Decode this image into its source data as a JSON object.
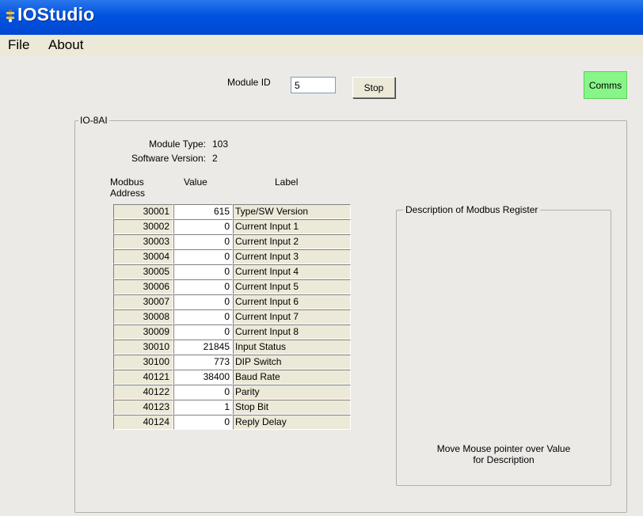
{
  "window": {
    "title": "IOStudio",
    "icon": "app-icon"
  },
  "menu": {
    "items": [
      "File",
      "About"
    ]
  },
  "toolbar": {
    "module_id_label": "Module ID",
    "module_id_value": "5",
    "stop_label": "Stop",
    "comms_label": "Comms",
    "comms_color": "#87f587"
  },
  "module": {
    "group_title": "IO-8AI",
    "type_label": "Module Type:",
    "type_value": "103",
    "sw_label": "Software Version:",
    "sw_value": "2"
  },
  "table": {
    "header_address_1": "Modbus",
    "header_address_2": "Address",
    "header_value": "Value",
    "header_label": "Label",
    "rows": [
      {
        "address": "30001",
        "value": "615",
        "label": "Type/SW Version"
      },
      {
        "address": "30002",
        "value": "0",
        "label": "Current Input 1"
      },
      {
        "address": "30003",
        "value": "0",
        "label": "Current Input 2"
      },
      {
        "address": "30004",
        "value": "0",
        "label": "Current Input 3"
      },
      {
        "address": "30005",
        "value": "0",
        "label": "Current Input 4"
      },
      {
        "address": "30006",
        "value": "0",
        "label": "Current Input 5"
      },
      {
        "address": "30007",
        "value": "0",
        "label": "Current Input 6"
      },
      {
        "address": "30008",
        "value": "0",
        "label": "Current Input 7"
      },
      {
        "address": "30009",
        "value": "0",
        "label": "Current Input 8"
      },
      {
        "address": "30010",
        "value": "21845",
        "label": "Input Status"
      },
      {
        "address": "30100",
        "value": "773",
        "label": "DIP Switch"
      },
      {
        "address": "40121",
        "value": "38400",
        "label": "Baud Rate"
      },
      {
        "address": "40122",
        "value": "0",
        "label": "Parity"
      },
      {
        "address": "40123",
        "value": "1",
        "label": "Stop Bit"
      },
      {
        "address": "40124",
        "value": "0",
        "label": "Reply Delay"
      }
    ]
  },
  "description": {
    "title": "Description of Modbus Register",
    "hint_line1": "Move Mouse pointer over Value",
    "hint_line2": "for Description"
  }
}
